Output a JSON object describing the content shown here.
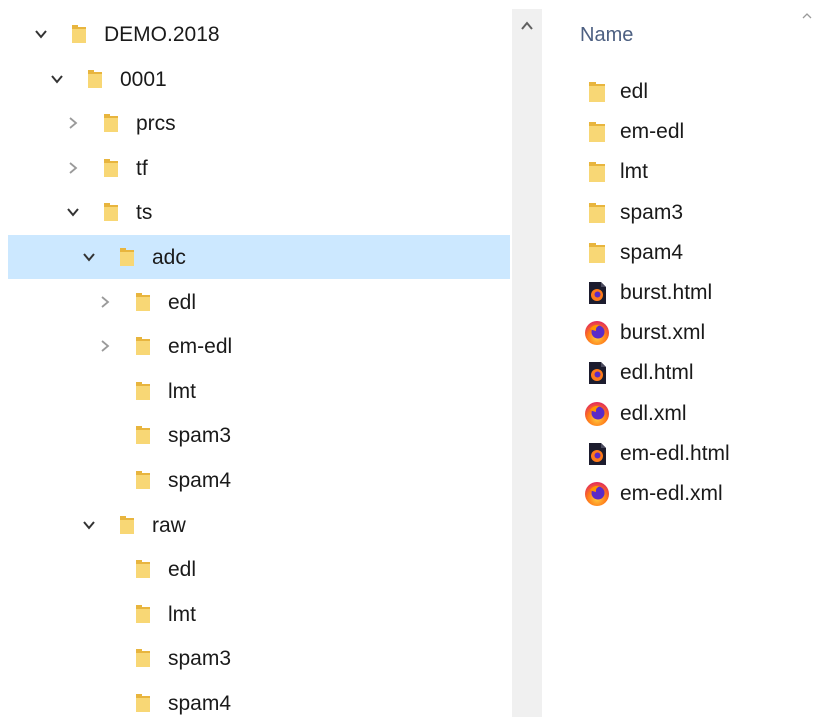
{
  "tree": {
    "items": [
      {
        "label": "DEMO.2018",
        "depth": 0,
        "chevron": "chevron-down",
        "icon": "folder-icon"
      },
      {
        "label": "0001",
        "depth": 1,
        "chevron": "chevron-down",
        "icon": "folder-icon"
      },
      {
        "label": "prcs",
        "depth": 2,
        "chevron": "chevron-right",
        "icon": "folder-icon"
      },
      {
        "label": "tf",
        "depth": 2,
        "chevron": "chevron-right",
        "icon": "folder-icon"
      },
      {
        "label": "ts",
        "depth": 2,
        "chevron": "chevron-down",
        "icon": "folder-icon"
      },
      {
        "label": "adc",
        "depth": 3,
        "chevron": "chevron-down",
        "icon": "folder-icon",
        "selected": true
      },
      {
        "label": "edl",
        "depth": 4,
        "chevron": "chevron-right",
        "icon": "folder-icon"
      },
      {
        "label": "em-edl",
        "depth": 4,
        "chevron": "chevron-right",
        "icon": "folder-icon"
      },
      {
        "label": "lmt",
        "depth": 4,
        "chevron": "none",
        "icon": "folder-icon"
      },
      {
        "label": "spam3",
        "depth": 4,
        "chevron": "none",
        "icon": "folder-icon"
      },
      {
        "label": "spam4",
        "depth": 4,
        "chevron": "none",
        "icon": "folder-icon"
      },
      {
        "label": "raw",
        "depth": 3,
        "chevron": "chevron-down",
        "icon": "folder-icon"
      },
      {
        "label": "edl",
        "depth": 4,
        "chevron": "none",
        "icon": "folder-icon"
      },
      {
        "label": "lmt",
        "depth": 4,
        "chevron": "none",
        "icon": "folder-icon"
      },
      {
        "label": "spam3",
        "depth": 4,
        "chevron": "none",
        "icon": "folder-icon"
      },
      {
        "label": "spam4",
        "depth": 4,
        "chevron": "none",
        "icon": "folder-icon"
      }
    ]
  },
  "file_list": {
    "column_header": "Name",
    "sort_indicator": "caret-up-icon",
    "items": [
      {
        "name": "edl",
        "icon": "folder-icon"
      },
      {
        "name": "em-edl",
        "icon": "folder-icon"
      },
      {
        "name": "lmt",
        "icon": "folder-icon"
      },
      {
        "name": "spam3",
        "icon": "folder-icon"
      },
      {
        "name": "spam4",
        "icon": "folder-icon"
      },
      {
        "name": "burst.html",
        "icon": "firefox-html-icon"
      },
      {
        "name": "burst.xml",
        "icon": "firefox-icon"
      },
      {
        "name": "edl.html",
        "icon": "firefox-html-icon"
      },
      {
        "name": "edl.xml",
        "icon": "firefox-icon"
      },
      {
        "name": "em-edl.html",
        "icon": "firefox-html-icon"
      },
      {
        "name": "em-edl.xml",
        "icon": "firefox-icon"
      }
    ]
  },
  "colors": {
    "selection": "#cce8ff",
    "folder": "#f8d775",
    "header_text": "#4d6082",
    "scrollbar": "#f0f0f0"
  }
}
